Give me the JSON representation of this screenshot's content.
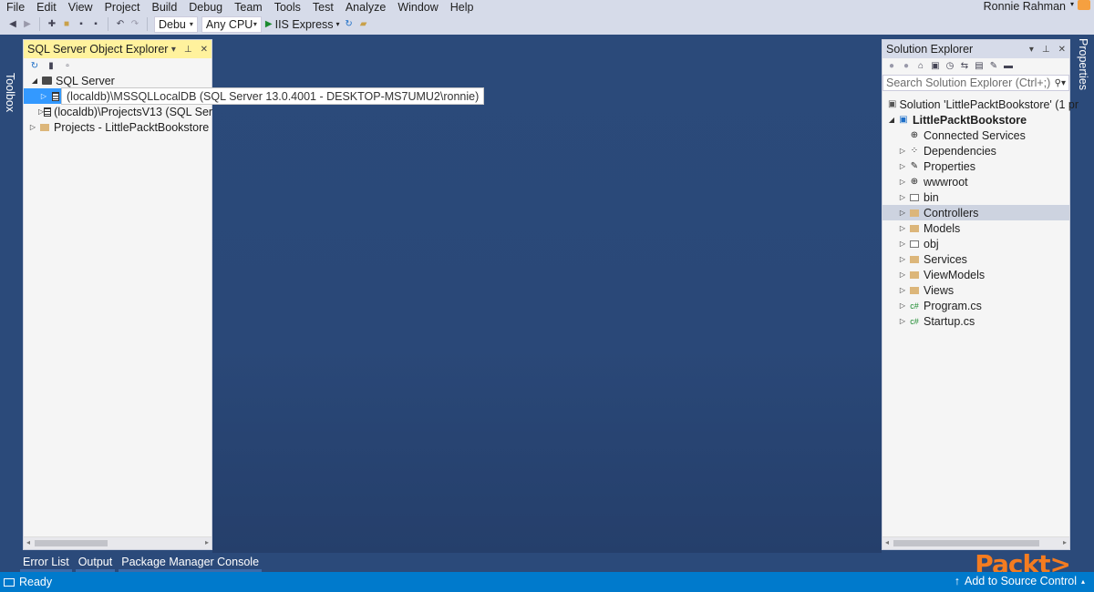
{
  "menu": [
    "File",
    "Edit",
    "View",
    "Project",
    "Build",
    "Debug",
    "Team",
    "Tools",
    "Test",
    "Analyze",
    "Window",
    "Help"
  ],
  "user": {
    "name": "Ronnie Rahman"
  },
  "toolbar": {
    "config": "Debu",
    "platform": "Any CPU",
    "run_target": "IIS Express"
  },
  "side_tabs": {
    "left": "Toolbox",
    "right": "Properties"
  },
  "sql_explorer": {
    "title": "SQL Server Object Explorer",
    "root": "SQL Server",
    "nodes": [
      "(localdb)\\MSSQLLocalDB (SQL Server 13.0.4001 - DESKTOP-MS7UMU2\\ronnie)",
      "(localdb)\\ProjectsV13 (SQL Ser"
    ],
    "projects": "Projects - LittlePacktBookstore",
    "tooltip": "(localdb)\\MSSQLLocalDB (SQL Server 13.0.4001 - DESKTOP-MS7UMU2\\ronnie)"
  },
  "solution_explorer": {
    "title": "Solution Explorer",
    "search_placeholder": "Search Solution Explorer (Ctrl+;)",
    "solution": "Solution 'LittlePacktBookstore' (1 pr",
    "project": "LittlePacktBookstore",
    "items": [
      {
        "label": "Connected Services",
        "icon": "connected-services-icon"
      },
      {
        "label": "Dependencies",
        "icon": "dependencies-icon"
      },
      {
        "label": "Properties",
        "icon": "wrench-icon"
      },
      {
        "label": "wwwroot",
        "icon": "globe-icon"
      },
      {
        "label": "bin",
        "icon": "folder-empty-icon"
      },
      {
        "label": "Controllers",
        "icon": "folder-icon"
      },
      {
        "label": "Models",
        "icon": "folder-icon"
      },
      {
        "label": "obj",
        "icon": "folder-empty-icon"
      },
      {
        "label": "Services",
        "icon": "folder-icon"
      },
      {
        "label": "ViewModels",
        "icon": "folder-icon"
      },
      {
        "label": "Views",
        "icon": "folder-icon"
      },
      {
        "label": "Program.cs",
        "icon": "csharp-file-icon"
      },
      {
        "label": "Startup.cs",
        "icon": "csharp-file-icon"
      }
    ]
  },
  "bottom_tabs": [
    "Error List",
    "Output",
    "Package Manager Console"
  ],
  "status": {
    "ready": "Ready",
    "source_control": "Add to Source Control"
  },
  "logo": "Packt>",
  "colors": {
    "accent": "#007acc",
    "selection": "#3399ff",
    "active_title": "#fff29d",
    "background": "#2b4a7a"
  }
}
